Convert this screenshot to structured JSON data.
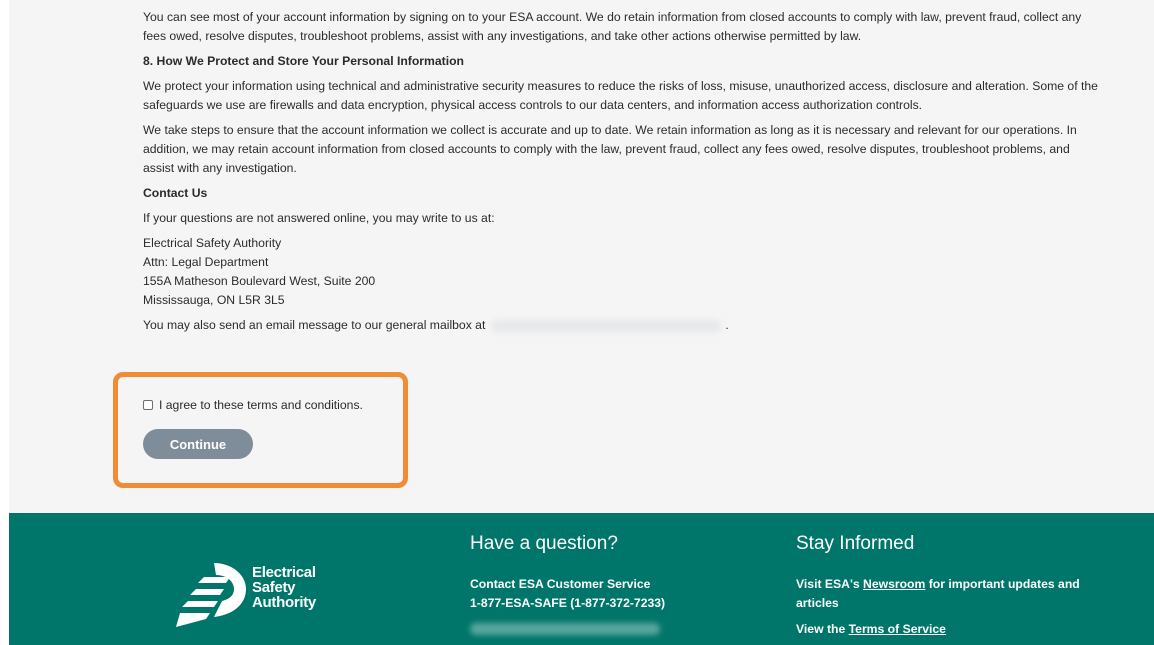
{
  "content": {
    "para_intro": "You can see most of your account information by signing on to your ESA account. We do retain information from closed accounts to comply with law, prevent fraud, collect any fees owed, resolve disputes, troubleshoot problems, assist with any investigations, and take other actions otherwise permitted by law.",
    "section8_heading": "8. How We Protect and Store Your Personal Information",
    "section8_p1": "We protect your information using technical and administrative security measures to reduce the risks of loss, misuse, unauthorized access, disclosure and alteration. Some of the safeguards we use are firewalls and data encryption, physical access controls to our data centers, and information access authorization controls.",
    "section8_p2": "We take steps to ensure that the account information we collect is accurate and up to date. We retain information as long as it is necessary and relevant for our operations. In addition, we may retain account information from closed accounts to comply with the law, prevent fraud, collect any fees owed, resolve disputes, troubleshoot problems, and assist with any investigation.",
    "contact_heading": "Contact Us",
    "contact_intro": "If your questions are not answered online, you may write to us at:",
    "address": [
      "Electrical Safety Authority",
      "Attn: Legal Department",
      "155A Matheson Boulevard West, Suite 200",
      "Mississauga, ON L5R 3L5"
    ],
    "email_prefix": "You may also send an email message to our general mailbox at",
    "email_suffix": "."
  },
  "form": {
    "agree_label": "I agree to these terms and conditions.",
    "agree_checked": false,
    "continue_label": "Continue"
  },
  "footer": {
    "logo_lines": [
      "Electrical",
      "Safety",
      "Authority"
    ],
    "question_heading": "Have a question?",
    "contact_label": "Contact ESA Customer Service",
    "contact_phone": "1-877-ESA-SAFE (1-877-372-7233)",
    "informed_heading": "Stay Informed",
    "visit_prefix": "Visit ESA's",
    "newsroom_link": "Newsroom",
    "visit_suffix": "for important updates and",
    "visit_suffix2": "articles",
    "view_prefix": "View the",
    "terms_link": "Terms of Service"
  },
  "colors": {
    "footer_bg": "#00766a",
    "highlight": "#ef8c36",
    "button_bg": "#7f8c9a"
  }
}
